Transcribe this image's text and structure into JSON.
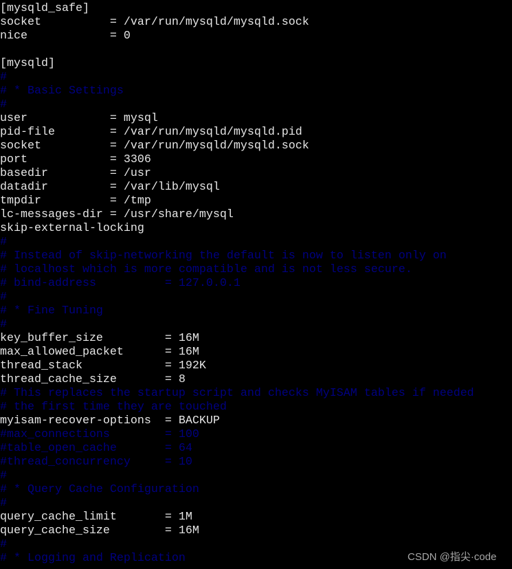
{
  "colors": {
    "background": "#000000",
    "text": "#e6e6e6",
    "comment": "#000080"
  },
  "terminal": {
    "lines": [
      {
        "text": "[mysqld_safe]",
        "comment": false
      },
      {
        "text": "socket          = /var/run/mysqld/mysqld.sock",
        "comment": false
      },
      {
        "text": "nice            = 0",
        "comment": false
      },
      {
        "text": "",
        "comment": false
      },
      {
        "text": "[mysqld]",
        "comment": false
      },
      {
        "text": "#",
        "comment": true
      },
      {
        "text": "# * Basic Settings",
        "comment": true
      },
      {
        "text": "#",
        "comment": true
      },
      {
        "text": "user            = mysql",
        "comment": false
      },
      {
        "text": "pid-file        = /var/run/mysqld/mysqld.pid",
        "comment": false
      },
      {
        "text": "socket          = /var/run/mysqld/mysqld.sock",
        "comment": false
      },
      {
        "text": "port            = 3306",
        "comment": false
      },
      {
        "text": "basedir         = /usr",
        "comment": false
      },
      {
        "text": "datadir         = /var/lib/mysql",
        "comment": false
      },
      {
        "text": "tmpdir          = /tmp",
        "comment": false
      },
      {
        "text": "lc-messages-dir = /usr/share/mysql",
        "comment": false
      },
      {
        "text": "skip-external-locking",
        "comment": false
      },
      {
        "text": "#",
        "comment": true
      },
      {
        "text": "# Instead of skip-networking the default is now to listen only on",
        "comment": true
      },
      {
        "text": "# localhost which is more compatible and is not less secure.",
        "comment": true
      },
      {
        "text": "# bind-address          = 127.0.0.1",
        "comment": true
      },
      {
        "text": "#",
        "comment": true
      },
      {
        "text": "# * Fine Tuning",
        "comment": true
      },
      {
        "text": "#",
        "comment": true
      },
      {
        "text": "key_buffer_size         = 16M",
        "comment": false
      },
      {
        "text": "max_allowed_packet      = 16M",
        "comment": false
      },
      {
        "text": "thread_stack            = 192K",
        "comment": false
      },
      {
        "text": "thread_cache_size       = 8",
        "comment": false
      },
      {
        "text": "# This replaces the startup script and checks MyISAM tables if needed",
        "comment": true
      },
      {
        "text": "# the first time they are touched",
        "comment": true
      },
      {
        "text": "myisam-recover-options  = BACKUP",
        "comment": false
      },
      {
        "text": "#max_connections        = 100",
        "comment": true
      },
      {
        "text": "#table_open_cache       = 64",
        "comment": true
      },
      {
        "text": "#thread_concurrency     = 10",
        "comment": true
      },
      {
        "text": "#",
        "comment": true
      },
      {
        "text": "# * Query Cache Configuration",
        "comment": true
      },
      {
        "text": "#",
        "comment": true
      },
      {
        "text": "query_cache_limit       = 1M",
        "comment": false
      },
      {
        "text": "query_cache_size        = 16M",
        "comment": false
      },
      {
        "text": "#",
        "comment": true
      },
      {
        "text": "# * Logging and Replication",
        "comment": true
      }
    ]
  },
  "watermark": "CSDN @指尖·code"
}
